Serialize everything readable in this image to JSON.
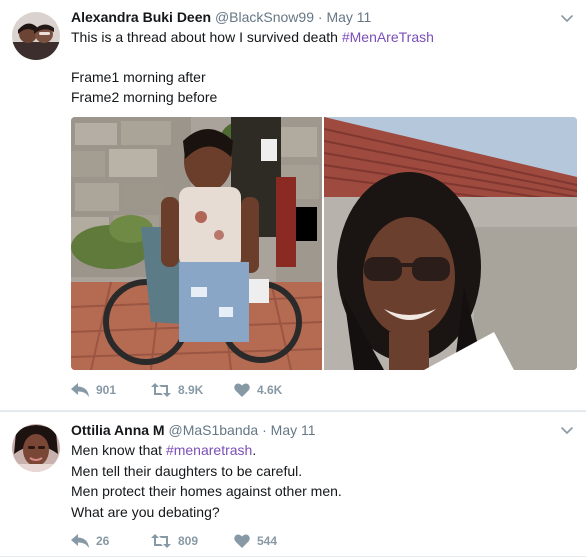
{
  "tweets": [
    {
      "author_name": "Alexandra Buki Deen",
      "handle": "@BlackSnow99",
      "separator": "·",
      "date": "May 11",
      "lines": [
        {
          "text": "This is a thread about how I survived death ",
          "hashtag": "#MenAreTrash"
        },
        {
          "text": ""
        },
        {
          "text": "Frame1 morning after"
        },
        {
          "text": "Frame2 morning before"
        }
      ],
      "replies": "901",
      "retweets": "8.9K",
      "likes": "4.6K"
    },
    {
      "author_name": "Ottilia Anna M",
      "handle": "@MaS1banda",
      "separator": "·",
      "date": "May 11",
      "lines": [
        {
          "text": "Men know that ",
          "hashtag": "#menaretrash",
          "after": "."
        },
        {
          "text": "Men tell their daughters to be careful."
        },
        {
          "text": "Men protect their homes against other men."
        },
        {
          "text": "What are you debating?"
        }
      ],
      "replies": "26",
      "retweets": "809",
      "likes": "544"
    }
  ],
  "colors": {
    "text": "#14171a",
    "meta": "#657786",
    "hashtag": "#7b4eb8",
    "action": "#8899a6",
    "divider": "#e6ecf0"
  },
  "icons": {
    "reply": "reply-icon",
    "retweet": "retweet-icon",
    "like": "heart-icon",
    "more": "chevron-down-icon"
  }
}
